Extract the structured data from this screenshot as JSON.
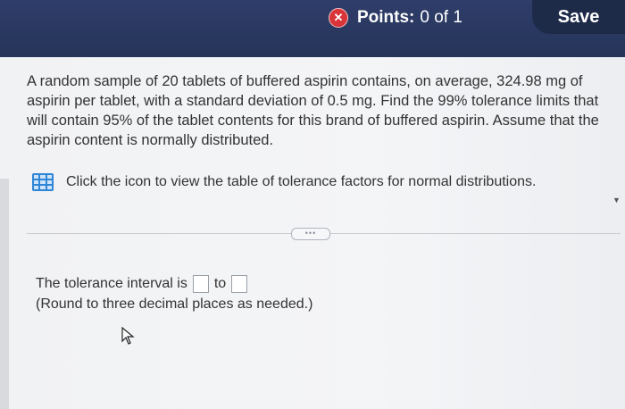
{
  "header": {
    "points_label": "Points:",
    "points_value": "0 of 1",
    "save_label": "Save"
  },
  "question": {
    "text": "A random sample of 20 tablets of buffered aspirin contains, on average, 324.98 mg of aspirin per tablet, with a standard deviation of 0.5 mg. Find the 99% tolerance limits that will contain 95% of the tablet contents for this brand of buffered aspirin. Assume that the aspirin content is normally distributed."
  },
  "tool": {
    "label": "Click the icon to view the table of tolerance factors for normal distributions."
  },
  "answer": {
    "prefix": "The tolerance interval is",
    "middle": "to",
    "hint": "(Round to three decimal places as needed.)",
    "lower_value": "",
    "upper_value": ""
  },
  "icons": {
    "incorrect": "x-circle-icon",
    "table": "table-icon",
    "cursor": "mouse-pointer-icon"
  },
  "colors": {
    "header_bg": "#2f3e6a",
    "save_bg": "#1d2a48",
    "error_red": "#d8343a",
    "icon_blue": "#2e86d6"
  }
}
